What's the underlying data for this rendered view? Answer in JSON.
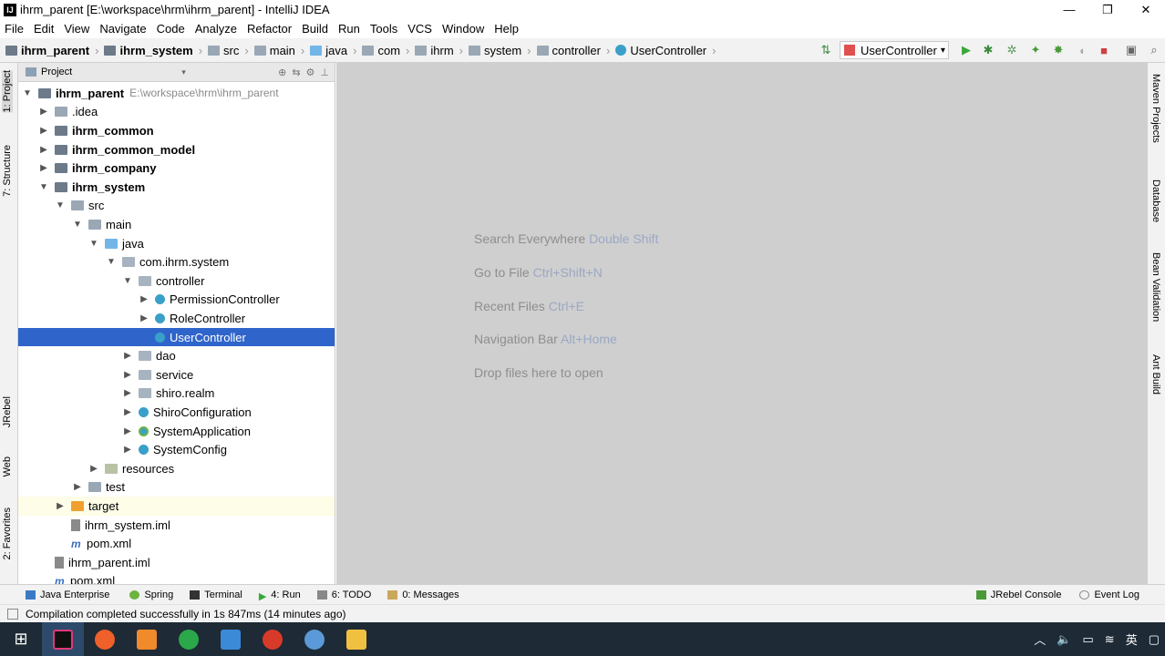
{
  "window": {
    "title": "ihrm_parent [E:\\workspace\\hrm\\ihrm_parent] - IntelliJ IDEA",
    "min": "—",
    "max": "❐",
    "close": "✕"
  },
  "menu": [
    "File",
    "Edit",
    "View",
    "Navigate",
    "Code",
    "Analyze",
    "Refactor",
    "Build",
    "Run",
    "Tools",
    "VCS",
    "Window",
    "Help"
  ],
  "breadcrumbs": [
    "ihrm_parent",
    "ihrm_system",
    "src",
    "main",
    "java",
    "com",
    "ihrm",
    "system",
    "controller",
    "UserController"
  ],
  "run_config": "UserController",
  "left_tabs": [
    "1: Project",
    "7: Structure",
    "JRebel",
    "Web",
    "2: Favorites"
  ],
  "right_tabs": [
    "Maven Projects",
    "Database",
    "Bean Validation",
    "Ant Build"
  ],
  "project": {
    "header": "Project",
    "tree": [
      {
        "label": "ihrm_parent",
        "path": "E:\\workspace\\hrm\\ihrm_parent",
        "bold": true
      },
      {
        "label": ".idea"
      },
      {
        "label": "ihrm_common",
        "bold": true
      },
      {
        "label": "ihrm_common_model",
        "bold": true
      },
      {
        "label": "ihrm_company",
        "bold": true
      },
      {
        "label": "ihrm_system",
        "bold": true
      },
      {
        "label": "src"
      },
      {
        "label": "main"
      },
      {
        "label": "java"
      },
      {
        "label": "com.ihrm.system"
      },
      {
        "label": "controller"
      },
      {
        "label": "PermissionController"
      },
      {
        "label": "RoleController"
      },
      {
        "label": "UserController"
      },
      {
        "label": "dao"
      },
      {
        "label": "service"
      },
      {
        "label": "shiro.realm"
      },
      {
        "label": "ShiroConfiguration"
      },
      {
        "label": "SystemApplication"
      },
      {
        "label": "SystemConfig"
      },
      {
        "label": "resources"
      },
      {
        "label": "test"
      },
      {
        "label": "target"
      },
      {
        "label": "ihrm_system.iml"
      },
      {
        "label": "pom.xml"
      },
      {
        "label": "ihrm_parent.iml"
      },
      {
        "label": "pom.xml"
      }
    ]
  },
  "editor_hints": [
    {
      "text": "Search Everywhere",
      "key": "Double Shift"
    },
    {
      "text": "Go to File",
      "key": "Ctrl+Shift+N"
    },
    {
      "text": "Recent Files",
      "key": "Ctrl+E"
    },
    {
      "text": "Navigation Bar",
      "key": "Alt+Home"
    },
    {
      "text": "Drop files here to open",
      "key": ""
    }
  ],
  "tool_windows": [
    "Java Enterprise",
    "Spring",
    "Terminal",
    "4: Run",
    "6: TODO",
    "0: Messages"
  ],
  "tool_windows_right": [
    "JRebel Console",
    "Event Log"
  ],
  "status": "Compilation completed successfully in 1s 847ms (14 minutes ago)",
  "tray": {
    "lang": "英"
  }
}
